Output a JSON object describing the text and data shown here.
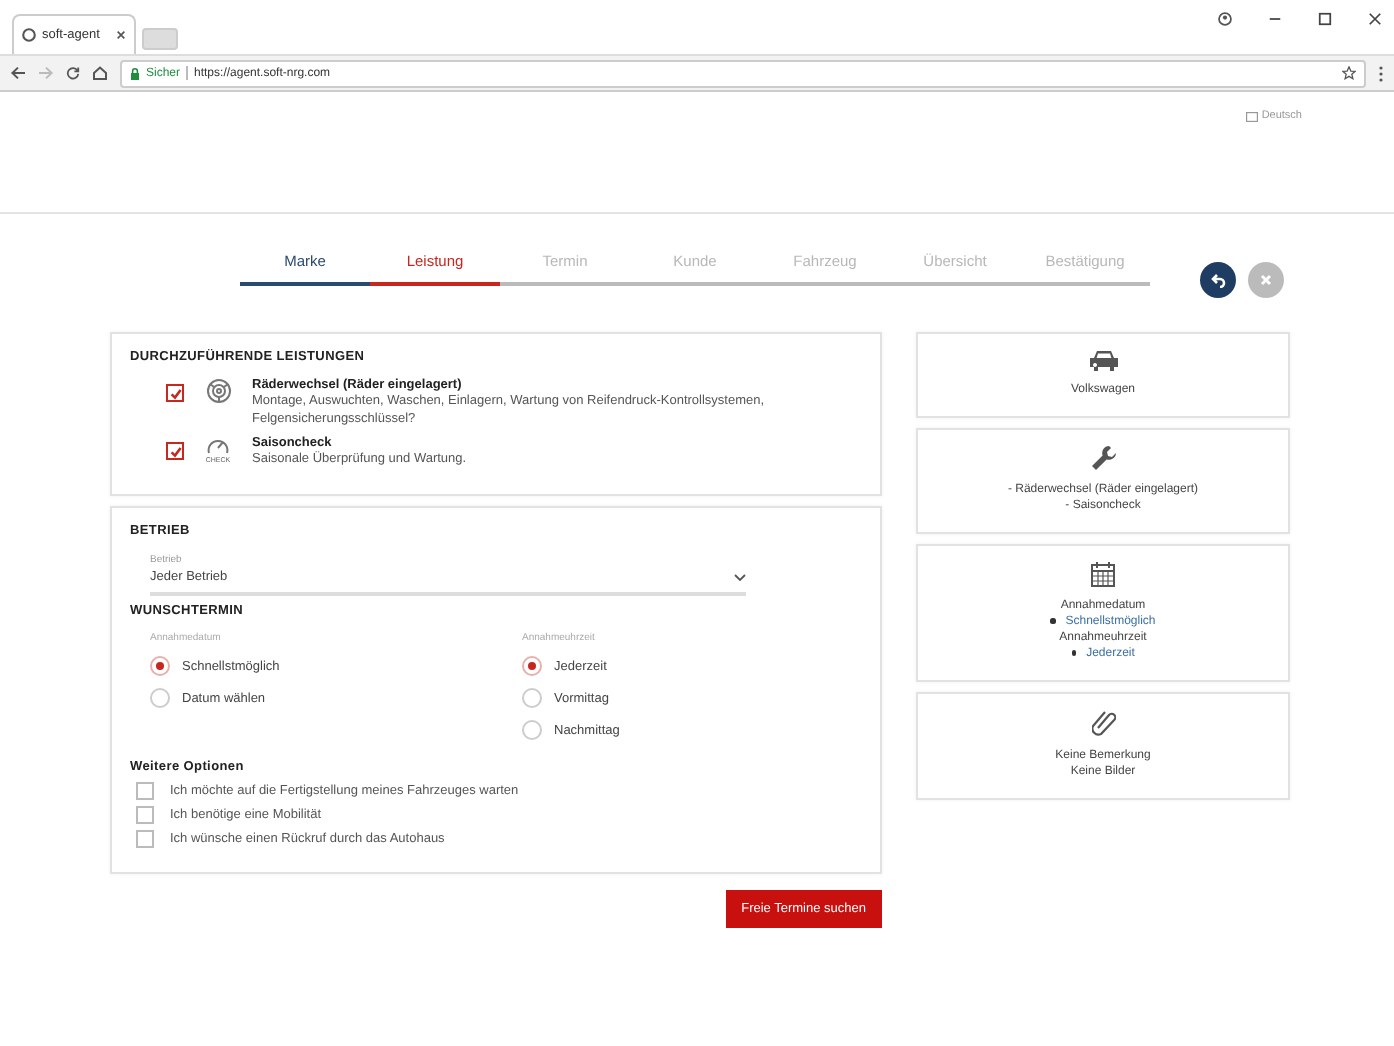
{
  "browser": {
    "tab_title": "soft-agent",
    "security_label": "Sicher",
    "url": "https://agent.soft-nrg.com"
  },
  "language": "Deutsch",
  "steps": [
    {
      "label": "Marke",
      "done": true,
      "selected": false
    },
    {
      "label": "Leistung",
      "done": false,
      "selected": true
    },
    {
      "label": "Termin",
      "done": false,
      "selected": false
    },
    {
      "label": "Kunde",
      "done": false,
      "selected": false
    },
    {
      "label": "Fahrzeug",
      "done": false,
      "selected": false
    },
    {
      "label": "Übersicht",
      "done": false,
      "selected": false
    },
    {
      "label": "Bestätigung",
      "done": false,
      "selected": false
    }
  ],
  "services": {
    "title": "DURCHZUFÜHRENDE LEISTUNGEN",
    "items": [
      {
        "name": "Räderwechsel (Räder eingelagert)",
        "description": "Montage, Auswuchten, Waschen, Einlagern, Wartung von Reifendruck-Kontrollsystemen, Felgensicherungsschlüssel?",
        "checked": true
      },
      {
        "icon_caption": "CHECK",
        "name": "Saisoncheck",
        "description": "Saisonale Überprüfung und Wartung.",
        "checked": true
      }
    ]
  },
  "betrieb": {
    "title": "BETRIEB",
    "select": {
      "label": "Betrieb",
      "value": "Jeder Betrieb"
    }
  },
  "wunschtermin": {
    "title": "WUNSCHTERMIN",
    "groups": [
      {
        "label": "Annahmedatum",
        "options": [
          {
            "label": "Schnellstmöglich",
            "selected": true
          },
          {
            "label": "Datum wählen",
            "selected": false
          }
        ]
      },
      {
        "label": "Annahmeuhrzeit",
        "options": [
          {
            "label": "Jederzeit",
            "selected": true
          },
          {
            "label": "Vormittag",
            "selected": false
          },
          {
            "label": "Nachmittag",
            "selected": false
          }
        ]
      }
    ]
  },
  "more_options": {
    "title": "Weitere Optionen",
    "options": [
      {
        "label": "Ich möchte auf die Fertigstellung meines Fahrzeuges warten",
        "checked": false
      },
      {
        "label": "Ich benötige eine Mobilität",
        "checked": false
      },
      {
        "label": "Ich wünsche einen Rückruf durch das Autohaus",
        "checked": false
      }
    ]
  },
  "submit": "Freie Termine suchen",
  "summary": [
    {
      "lines": [
        {
          "kind": "text",
          "text": "Volkswagen"
        }
      ]
    },
    {
      "lines": [
        {
          "kind": "text",
          "text": "- Räderwechsel (Räder eingelagert)"
        },
        {
          "kind": "text",
          "text": "- Saisoncheck"
        }
      ]
    },
    {
      "lines": [
        {
          "kind": "text",
          "text": "Annahmedatum"
        },
        {
          "kind": "bullet",
          "text": "Schnellstmöglich"
        },
        {
          "kind": "text",
          "text": "Annahmeuhrzeit"
        },
        {
          "kind": "bullet",
          "text": "Jederzeit"
        }
      ]
    },
    {
      "lines": [
        {
          "kind": "text",
          "text": "Keine Bemerkung"
        },
        {
          "kind": "text",
          "text": "Keine Bilder"
        }
      ]
    }
  ]
}
